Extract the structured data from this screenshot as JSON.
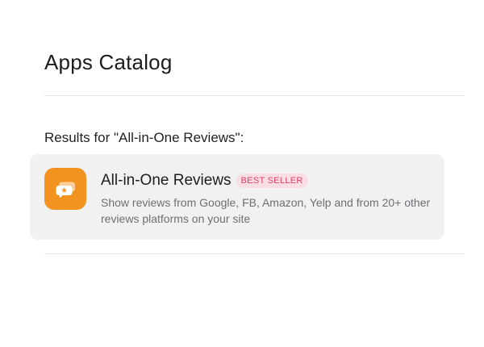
{
  "header": {
    "title": "Apps Catalog"
  },
  "search": {
    "results_label": "Results for \"All-in-One Reviews\":"
  },
  "results": [
    {
      "name": "All-in-One Reviews",
      "badge": "BEST SELLER",
      "description": "Show reviews from Google, FB, Amazon, Yelp and from 20+ other reviews platforms on your site",
      "icon": "speech-bubble-star-icon"
    }
  ],
  "colors": {
    "icon_background": "#f3931f",
    "badge_background": "#fbdde4",
    "badge_text": "#e0405f",
    "card_background": "#f1f1f2"
  }
}
